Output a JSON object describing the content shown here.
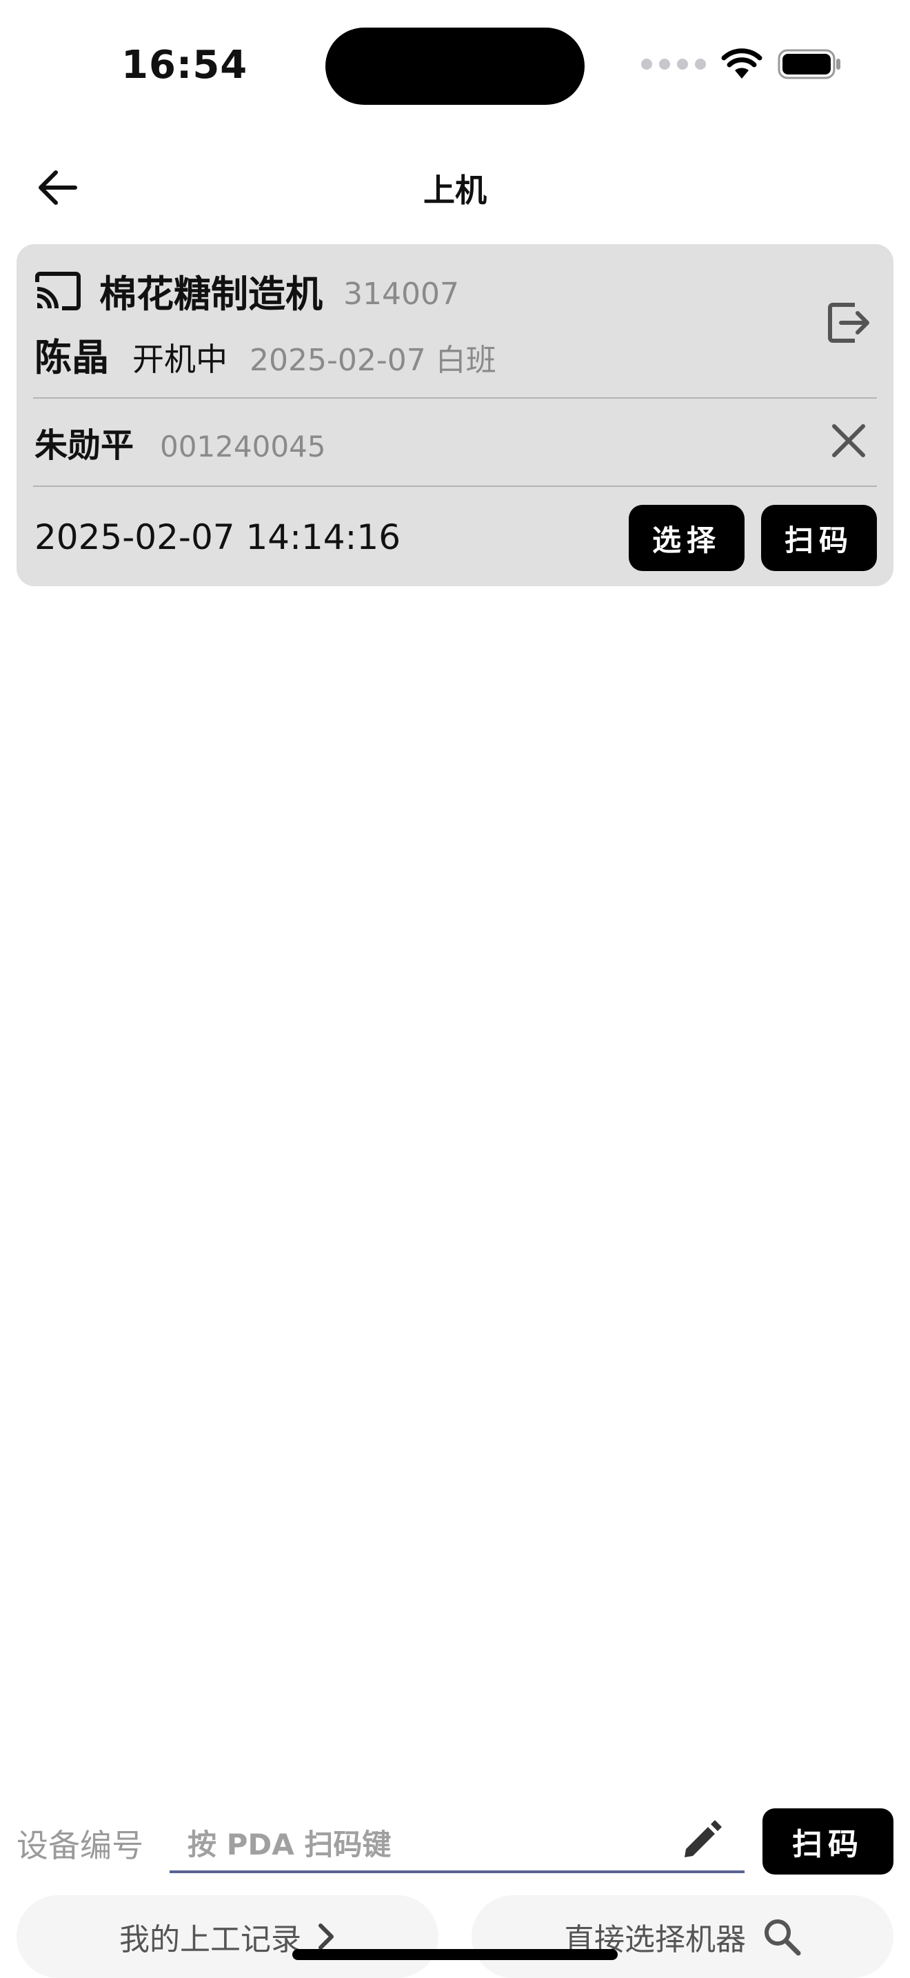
{
  "status_bar": {
    "time": "16:54"
  },
  "nav": {
    "title": "上机"
  },
  "card": {
    "machine_name": "棉花糖制造机",
    "machine_code": "314007",
    "operator_name": "陈晶",
    "operator_status": "开机中",
    "shift_info": "2025-02-07 白班",
    "worker_name": "朱勋平",
    "worker_id": "001240045",
    "datetime": "2025-02-07 14:14:16",
    "select_label": "选择",
    "scan_label": "扫码"
  },
  "device_input": {
    "label": "设备编号",
    "placeholder": "按 PDA 扫码键",
    "scan_label": "扫码"
  },
  "bottom": {
    "records_label": "我的上工记录",
    "select_machine_label": "直接选择机器"
  },
  "icons": {
    "back": "arrow-left-icon",
    "machine": "cast-icon",
    "exit": "exit-icon",
    "remove": "close-icon",
    "edit": "pencil-icon",
    "records_chevron": "chevron-right-icon",
    "search": "search-icon"
  }
}
